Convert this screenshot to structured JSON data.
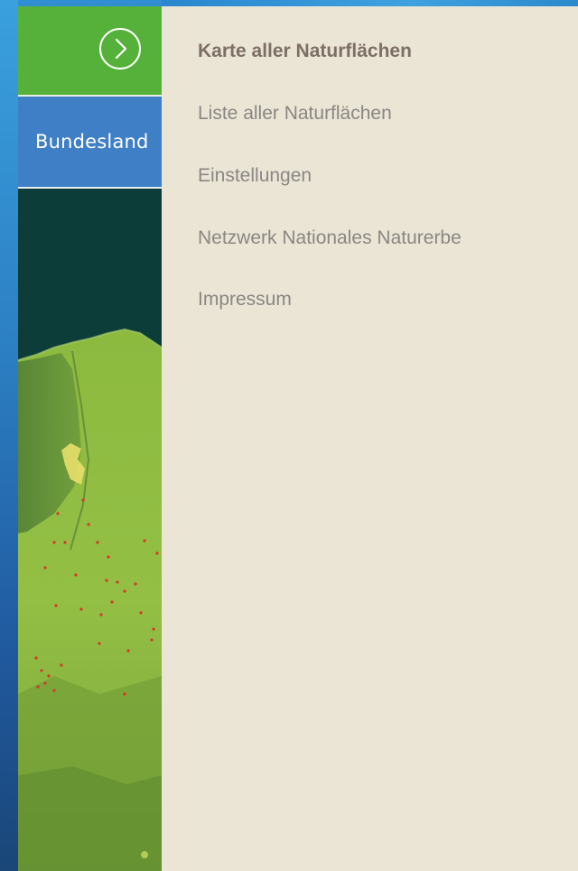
{
  "sidebar": {
    "toggle_icon": "chevron-right-circle-icon",
    "bundesland_label": "Bundesland",
    "colors": {
      "toggle_bg": "#56b13a",
      "bundesland_bg": "#3e7fc6"
    }
  },
  "map": {
    "description_icon": "satellite-map-thumbnail"
  },
  "menu": {
    "background": "#ebe5d6",
    "items": [
      {
        "label": "Karte aller Naturflächen",
        "active": true
      },
      {
        "label": "Liste aller Naturflächen",
        "active": false
      },
      {
        "label": "Einstellungen",
        "active": false
      },
      {
        "label": "Netzwerk Nationales Naturerbe",
        "active": false
      },
      {
        "label": "Impressum",
        "active": false
      }
    ]
  }
}
